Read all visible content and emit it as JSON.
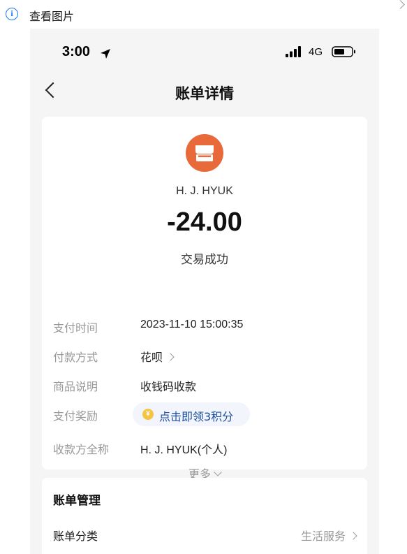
{
  "viewer": {
    "view_label": "查看图片"
  },
  "status_bar": {
    "time": "3:00",
    "network": "4G"
  },
  "nav": {
    "title": "账单详情"
  },
  "bill": {
    "payee_name": "H. J. HYUK",
    "amount": "-24.00",
    "status": "交易成功",
    "rows": [
      {
        "label": "支付时间",
        "value": "2023-11-10 15:00:35"
      },
      {
        "label": "付款方式",
        "value": "花呗"
      },
      {
        "label": "商品说明",
        "value": "收钱码收款"
      },
      {
        "label": "支付奖励",
        "value": "点击即领3积分"
      },
      {
        "label": "收款方全称",
        "value": "H. J. HYUK(个人)"
      }
    ],
    "more_label": "更多"
  },
  "management": {
    "title": "账单管理",
    "category_label": "账单分类",
    "category_value": "生活服务"
  },
  "colors": {
    "brand_blue": "#1677ff",
    "avatar_orange": "#e86a3b",
    "reward_text": "#1f4fa3",
    "background": "#f5f5f5"
  },
  "icons": {
    "info": "info-icon",
    "location": "location-arrow-icon",
    "signal": "signal-icon",
    "battery": "battery-icon",
    "back": "back-icon",
    "shop": "shop-icon",
    "coin": "coin-icon",
    "chevron": "chevron-right-icon"
  }
}
